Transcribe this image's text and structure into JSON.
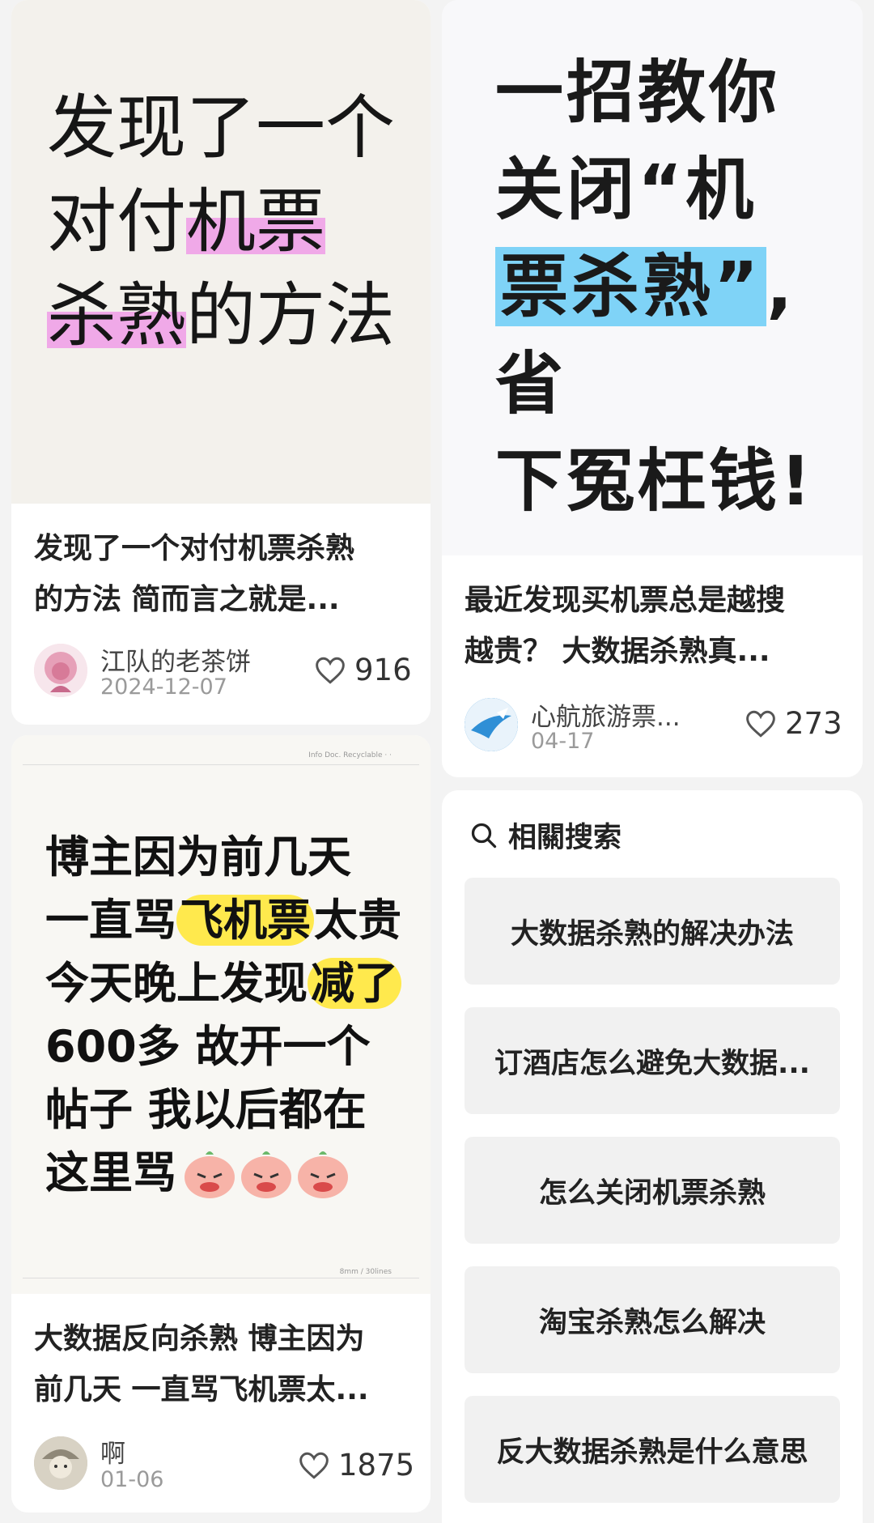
{
  "posts": [
    {
      "cover_lines": [
        "发现了一个",
        "对付",
        "机票",
        "杀熟",
        "的方法"
      ],
      "title_lines": [
        "发现了一个对付机票杀熟",
        "的方法 简而言之就是..."
      ],
      "author": "江队的老茶饼",
      "date": "2024-12-07",
      "likes": "916"
    },
    {
      "cover_lines": [
        "一招教你",
        "关闭“机",
        "票杀熟”",
        ",省",
        "下冤枉钱!"
      ],
      "title_lines": [
        "最近发现买机票总是越搜",
        "越贵？ 大数据杀熟真..."
      ],
      "author": "心航旅游票...",
      "date": "04-17",
      "likes": "273"
    },
    {
      "cover_header": "Info Doc.   Recyclable   ·   ·",
      "cover_footer": "8mm / 30lines",
      "cover_lines": [
        "博主因为前几天",
        "一直骂",
        "飞机票",
        "太贵",
        "今天晚上发现",
        "减了",
        "600多 故开一个",
        "帖子 我以后都在",
        "这里骂"
      ],
      "title_lines": [
        "大数据反向杀熟 博主因为",
        "前几天 一直骂飞机票太..."
      ],
      "author": "啊",
      "date": "01-06",
      "likes": "1875"
    }
  ],
  "related": {
    "title": "相關搜索",
    "items": [
      "大数据杀熟的解决办法",
      "订酒店怎么避免大数据...",
      "怎么关闭机票杀熟",
      "淘宝杀熟怎么解决",
      "反大数据杀熟是什么意思"
    ]
  },
  "colors": {
    "highlight_pink": "#f0a9e8",
    "highlight_yellow": "#ffe94d",
    "highlight_blue": "#7fd3f7"
  }
}
